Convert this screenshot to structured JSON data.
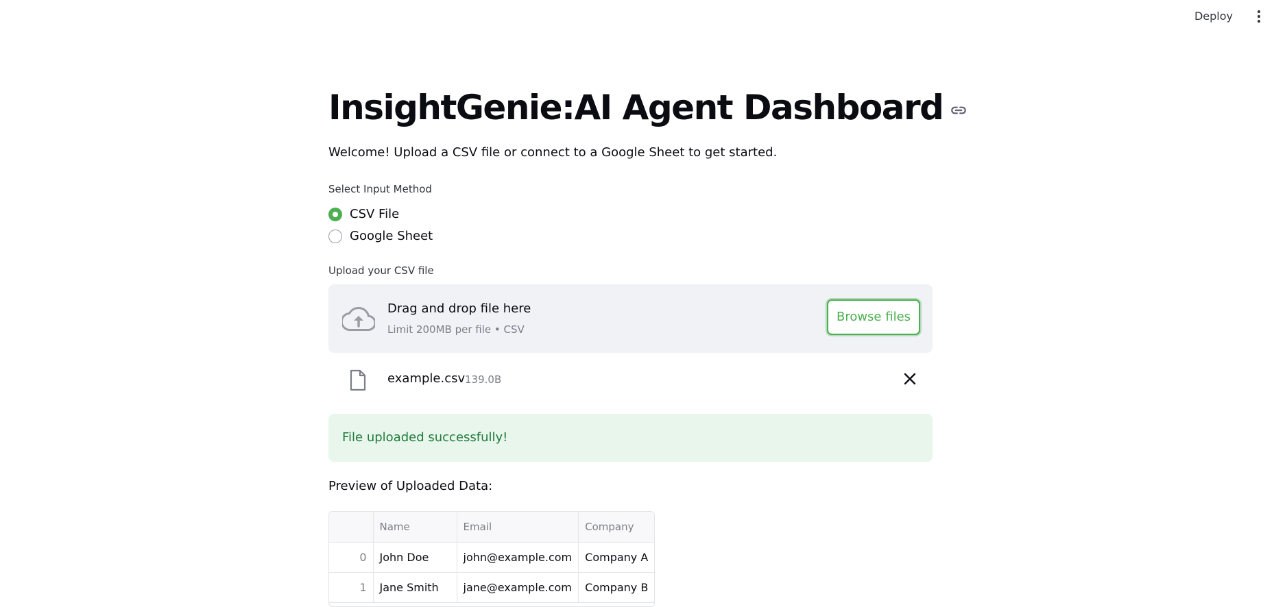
{
  "topbar": {
    "deploy_label": "Deploy",
    "menu_icon": "kebab-menu-icon"
  },
  "header": {
    "title": "InsightGenie:AI Agent Dashboard",
    "anchor_icon": "link-icon"
  },
  "intro": {
    "welcome": "Welcome! Upload a CSV file or connect to a Google Sheet to get started."
  },
  "input_method": {
    "label": "Select Input Method",
    "options": [
      {
        "label": "CSV File",
        "selected": true
      },
      {
        "label": "Google Sheet",
        "selected": false
      }
    ]
  },
  "uploader": {
    "label": "Upload your CSV file",
    "dropzone_title": "Drag and drop file here",
    "dropzone_limit": "Limit 200MB per file • CSV",
    "browse_label": "Browse files",
    "icon": "cloud-upload-icon",
    "file": {
      "name": "example.csv",
      "size": "139.0B",
      "icon": "file-icon",
      "remove_icon": "close-icon"
    }
  },
  "alert": {
    "message": "File uploaded successfully!",
    "color": "#1f7a3c",
    "background": "#e8f6ec"
  },
  "preview": {
    "label": "Preview of Uploaded Data:",
    "columns": [
      "",
      "Name",
      "Email",
      "Company"
    ],
    "rows": [
      [
        "0",
        "John Doe",
        "john@example.com",
        "Company A"
      ],
      [
        "1",
        "Jane Smith",
        "jane@example.com",
        "Company B"
      ]
    ]
  },
  "colors": {
    "accent": "#4caf50",
    "text": "#31333f",
    "dropzone_bg": "#f0f2f6"
  }
}
